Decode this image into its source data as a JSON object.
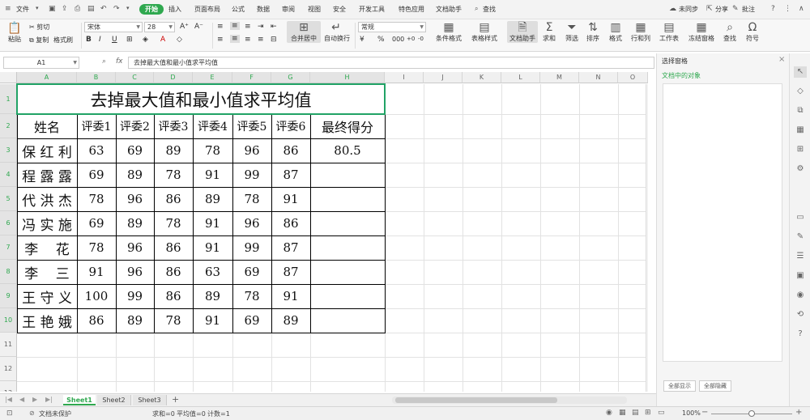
{
  "menubar": {
    "file": "文件",
    "tabs": [
      "开始",
      "插入",
      "页面布局",
      "公式",
      "数据",
      "审阅",
      "视图",
      "安全",
      "开发工具",
      "特色应用",
      "文档助手"
    ],
    "search": "查找",
    "sync": "未同步",
    "share": "分享",
    "comment": "批注"
  },
  "ribbon": {
    "paste": "粘贴",
    "cut": "剪切",
    "copy": "复制",
    "format_painter": "格式刷",
    "font_name": "宋体",
    "font_size": "28",
    "merge_center": "合并居中",
    "wrap_text": "自动换行",
    "number_format": "常规",
    "conditional_format": "条件格式",
    "table_style": "表格样式",
    "doc_assistant": "文档助手",
    "sum": "求和",
    "filter": "筛选",
    "sort": "排序",
    "format": "格式",
    "row_col": "行和列",
    "worksheet": "工作表",
    "freeze": "冻结窗格",
    "find": "查找",
    "symbol": "符号"
  },
  "formula_bar": {
    "name_box": "A1",
    "fx": "fx",
    "content": "去掉最大值和最小值求平均值"
  },
  "grid": {
    "columns": [
      "A",
      "B",
      "C",
      "D",
      "E",
      "F",
      "G",
      "H",
      "I",
      "J",
      "K",
      "L",
      "M",
      "N",
      "O"
    ],
    "rows": [
      "1",
      "2",
      "3",
      "4",
      "5",
      "6",
      "7",
      "8",
      "9",
      "10",
      "11",
      "12",
      "13"
    ],
    "title": "去掉最大值和最小值求平均值",
    "headers": [
      "姓名",
      "评委1",
      "评委2",
      "评委3",
      "评委4",
      "评委5",
      "评委6",
      "最终得分"
    ],
    "data": [
      [
        "保 红 利",
        "63",
        "69",
        "89",
        "78",
        "96",
        "86",
        "80.5"
      ],
      [
        "程 露 露",
        "69",
        "89",
        "78",
        "91",
        "99",
        "87",
        ""
      ],
      [
        "代 洪 杰",
        "78",
        "96",
        "86",
        "89",
        "78",
        "91",
        ""
      ],
      [
        "冯 实 施",
        "69",
        "89",
        "78",
        "91",
        "96",
        "86",
        ""
      ],
      [
        "李    花",
        "78",
        "96",
        "86",
        "91",
        "99",
        "87",
        ""
      ],
      [
        "李    三",
        "91",
        "96",
        "86",
        "63",
        "69",
        "87",
        ""
      ],
      [
        "王 守 义",
        "100",
        "99",
        "86",
        "89",
        "78",
        "91",
        ""
      ],
      [
        "王 艳 娥",
        "86",
        "89",
        "78",
        "91",
        "69",
        "89",
        ""
      ]
    ]
  },
  "right_panel": {
    "title": "选择窗格",
    "subtitle": "文档中的对象",
    "btn_show_all": "全部显示",
    "btn_hide_all": "全部隐藏"
  },
  "sheet_tabs": [
    "Sheet1",
    "Sheet2",
    "Sheet3"
  ],
  "status_bar": {
    "protect": "文档未保护",
    "sum": "求和=0",
    "avg": "平均值=0",
    "count": "计数=1",
    "zoom": "100%"
  },
  "colors": {
    "accent": "#2fa84f",
    "selection": "#21a366"
  }
}
